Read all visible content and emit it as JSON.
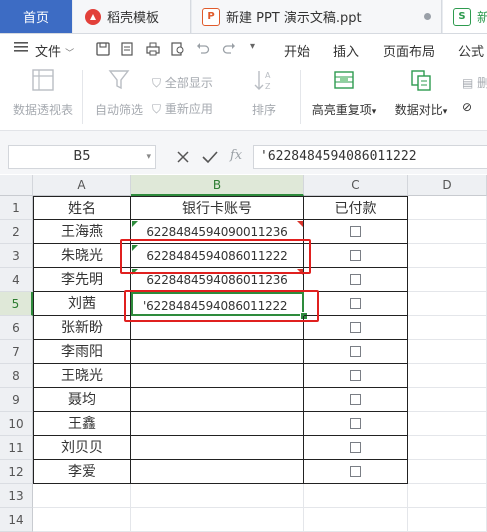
{
  "tabs": [
    {
      "label": "首页",
      "active": true
    },
    {
      "label": "稻壳模板",
      "icon": "docer-icon"
    },
    {
      "label": "新建 PPT 演示文稿.ppt",
      "icon": "ppt-icon"
    },
    {
      "label": "新",
      "icon": "sheet-icon"
    }
  ],
  "menu": {
    "file_label": "文件",
    "items": [
      "开始",
      "插入",
      "页面布局",
      "公式"
    ]
  },
  "ribbon": {
    "pivot_label": "数据透视表",
    "autofilter_label": "自动筛选",
    "show_all_label": "全部显示",
    "reapply_label": "重新应用",
    "sort_label": "排序",
    "highlight_dup_label": "高亮重复项",
    "compare_label": "数据对比",
    "delete_dup_label": "删"
  },
  "formula_bar": {
    "name_box": "B5",
    "fx_label": "fx",
    "value": "'6228484594086011222"
  },
  "sheet": {
    "columns": [
      "A",
      "B",
      "C",
      "D"
    ],
    "rows": [
      "1",
      "2",
      "3",
      "4",
      "5",
      "6",
      "7",
      "8",
      "9",
      "10",
      "11",
      "12",
      "13",
      "14"
    ],
    "headers": {
      "name": "姓名",
      "account": "银行卡账号",
      "paid": "已付款"
    },
    "records": [
      {
        "name": "王海燕",
        "account": "6228484594090011236"
      },
      {
        "name": "朱晓光",
        "account": "6228484594086011222"
      },
      {
        "name": "李先明",
        "account": "6228484594086011236"
      },
      {
        "name": "刘茜",
        "account": "'6228484594086011222"
      },
      {
        "name": "张新盼",
        "account": ""
      },
      {
        "name": "李雨阳",
        "account": ""
      },
      {
        "name": "王晓光",
        "account": ""
      },
      {
        "name": "聂均",
        "account": ""
      },
      {
        "name": "王鑫",
        "account": ""
      },
      {
        "name": "刘贝贝",
        "account": ""
      },
      {
        "name": "李爱",
        "account": ""
      }
    ],
    "active_cell": "B5"
  },
  "colors": {
    "accent": "#3d6cc4",
    "selection": "#2e8b3c",
    "highlight_box": "#e0201f"
  }
}
